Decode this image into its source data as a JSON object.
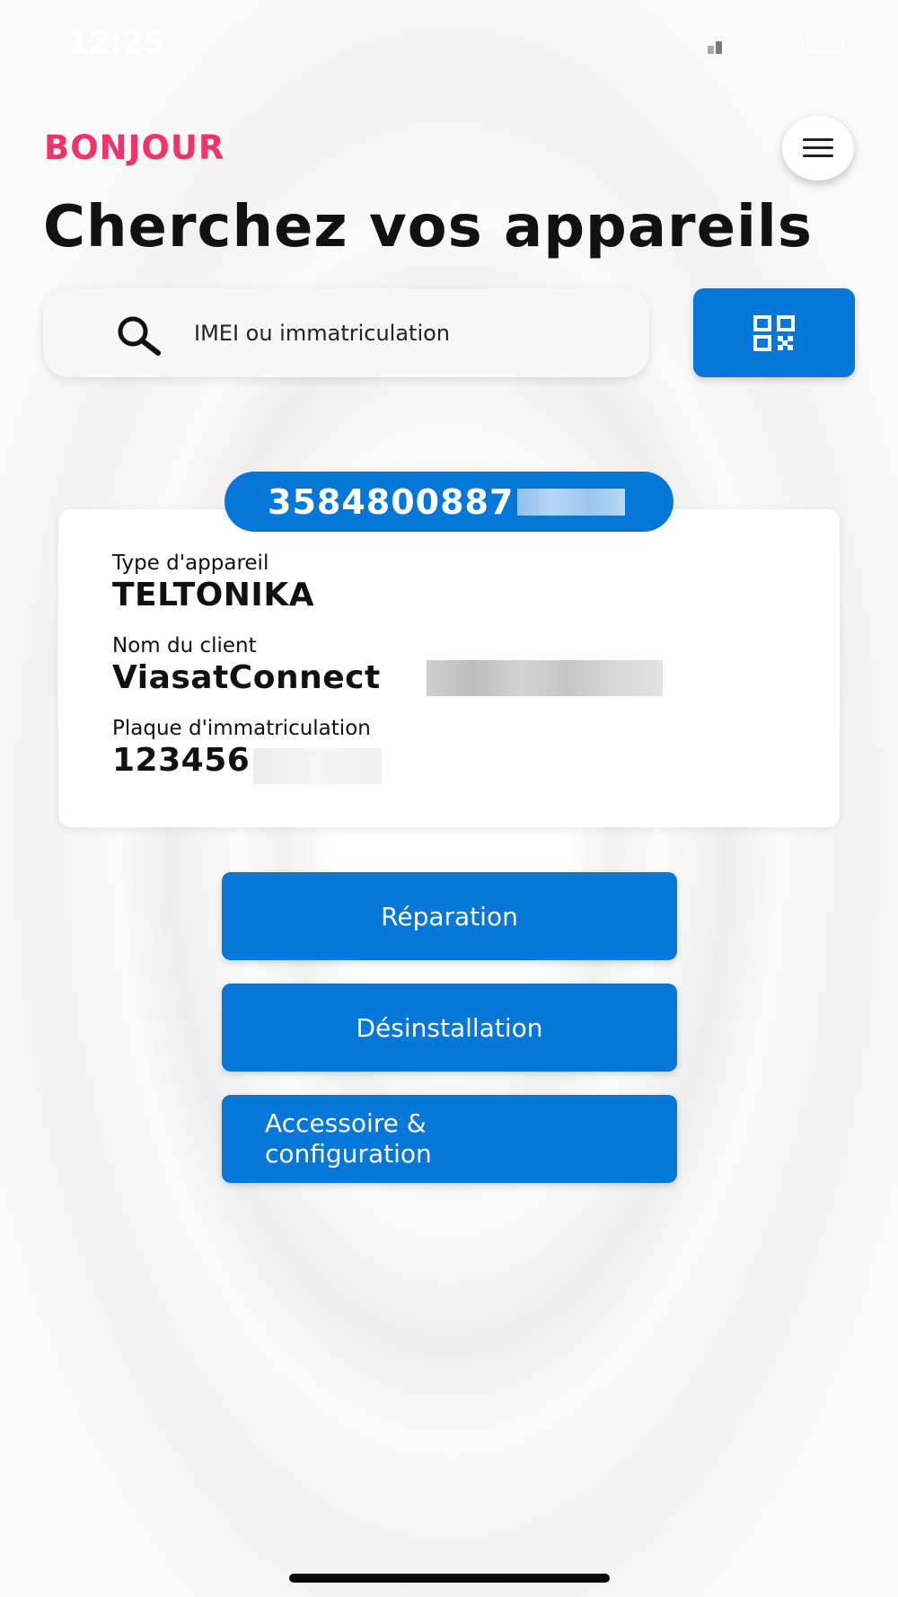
{
  "status_bar": {
    "time": "12:25"
  },
  "header": {
    "greeting": "BONJOUR",
    "title": "Cherchez vos appareils"
  },
  "search": {
    "placeholder": "IMEI ou immatriculation"
  },
  "device": {
    "imei_visible": "3584800887",
    "type_label": "Type d'appareil",
    "type_value": "TELTONIKA",
    "client_label": "Nom du client",
    "client_value": "ViasatConnect",
    "plate_label": "Plaque d'immatriculation",
    "plate_value": "123456"
  },
  "actions": {
    "repair": "Réparation",
    "uninstall": "Désinstallation",
    "accessory": "Accessoire & configuration"
  },
  "colors": {
    "accent": "#0577d8",
    "greeting": "#f0346b"
  },
  "icons": [
    "search-icon",
    "qr-code-icon",
    "menu-icon"
  ]
}
